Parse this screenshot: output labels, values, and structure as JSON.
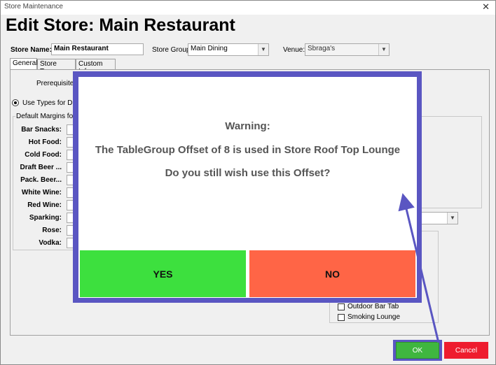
{
  "window": {
    "title": "Store  Maintenance",
    "close_glyph": "✕"
  },
  "heading": "Edit Store: Main Restaurant",
  "store_name": {
    "label": "Store Name:",
    "value": "Main Restaurant"
  },
  "store_group": {
    "label": "Store Group:",
    "value": "Main Dining"
  },
  "venue": {
    "label": "Venue:",
    "value": "Sbraga's"
  },
  "tabs": [
    {
      "label": "General"
    },
    {
      "label": "Store Types"
    },
    {
      "label": "Custom Info"
    }
  ],
  "general": {
    "prerequisite_label": "Prerequisite:",
    "use_types_label": "Use Types for Defa",
    "margins_group_label": "Default Margins for I",
    "margins": [
      {
        "label": "Bar Snacks:"
      },
      {
        "label": "Hot Food:"
      },
      {
        "label": "Cold Food:"
      },
      {
        "label": "Draft Beer  ..."
      },
      {
        "label": "Pack. Beer..."
      },
      {
        "label": "White Wine:"
      },
      {
        "label": "Red Wine:"
      },
      {
        "label": "Sparking:"
      },
      {
        "label": "Rose:"
      },
      {
        "label": "Vodka:"
      }
    ],
    "store_types": [
      {
        "label": "Outdoor Bar Tab"
      },
      {
        "label": "Smoking Lounge"
      }
    ]
  },
  "dialog": {
    "line1": "Warning:",
    "line2": "The TableGroup Offset of 8 is used in Store Roof Top Lounge",
    "line3": "Do you still wish use this Offset?",
    "yes_label": "YES",
    "no_label": "NO"
  },
  "footer": {
    "ok_label": "OK",
    "cancel_label": "Cancel"
  },
  "icons": {
    "dropdown": "chevron-down-icon",
    "close": "close-icon"
  },
  "colors": {
    "yes": "#3de03e",
    "no": "#ff6546",
    "ok": "#3fb63f",
    "cancel": "#ee1c2e",
    "highlight": "#5a56c2"
  }
}
